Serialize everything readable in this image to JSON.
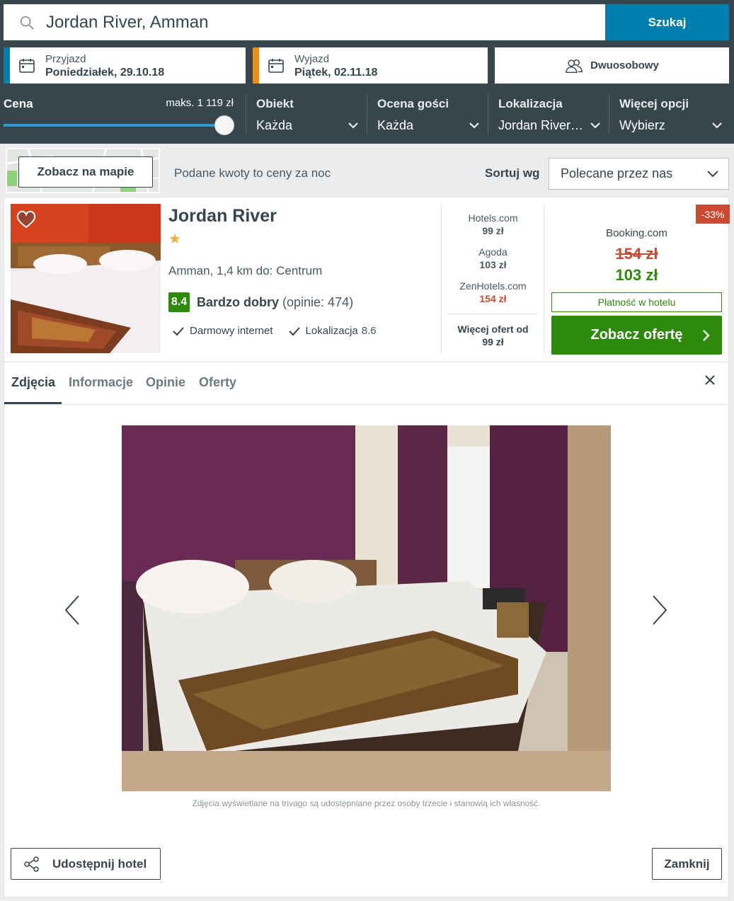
{
  "search": {
    "value": "Jordan River, Amman",
    "button": "Szukaj"
  },
  "checkin": {
    "label": "Przyjazd",
    "value": "Poniedziałek, 29.10.18",
    "accent": "#007fad"
  },
  "checkout": {
    "label": "Wyjazd",
    "value": "Piątek, 02.11.18",
    "accent": "#f28c0f"
  },
  "room": {
    "label": "Dwuosobowy"
  },
  "filters": {
    "price": {
      "label": "Cena",
      "max": "maks. 1 119 zł",
      "level": 1.0
    },
    "items": [
      {
        "label": "Obiekt",
        "value": "Każda"
      },
      {
        "label": "Ocena gości",
        "value": "Każda"
      },
      {
        "label": "Lokalizacja",
        "value": "Jordan River…"
      },
      {
        "label": "Więcej opcji",
        "value": "Wybierz"
      }
    ]
  },
  "sortbar": {
    "map_button": "Zobacz na mapie",
    "price_note": "Podane kwoty to ceny za noc",
    "sort_label": "Sortuj wg",
    "sort_value": "Polecane przez nas"
  },
  "hotel": {
    "name": "Jordan River",
    "stars": "★",
    "location": "Amman, 1,4 km do: Centrum",
    "rating_score": "8.4",
    "rating_word": "Bardzo dobry",
    "rating_count": "(opinie: 474)",
    "amenities": [
      {
        "label": "Darmowy internet",
        "value": ""
      },
      {
        "label": "Lokalizacja",
        "value": "8.6"
      }
    ],
    "offers": [
      {
        "site": "Hotels.com",
        "price": "99 zł"
      },
      {
        "site": "Agoda",
        "price": "103 zł"
      },
      {
        "site": "ZenHotels.com",
        "price": "154 zł"
      }
    ],
    "more_offers": "Więcej ofert od",
    "more_offers_price": "99 zł",
    "deal": {
      "discount": "-33%",
      "site": "Booking.com",
      "old_price": "154 zł",
      "new_price": "103 zł",
      "pay_note": "Płatność w hotelu",
      "button": "Zobacz ofertę"
    }
  },
  "tabs": [
    "Zdjęcia",
    "Informacje",
    "Opinie",
    "Oferty"
  ],
  "gallery": {
    "credit": "Zdjęcia wyświetlane na trivago są udostępniane przez osoby trzecie i stanowią ich własność."
  },
  "footer": {
    "share": "Udostępnij hotel",
    "close": "Zamknij"
  },
  "colors": {
    "dark": "#37454d",
    "blue": "#007fad",
    "green": "#2e8a0b",
    "red": "#c94a30",
    "orange": "#f28c0f"
  }
}
